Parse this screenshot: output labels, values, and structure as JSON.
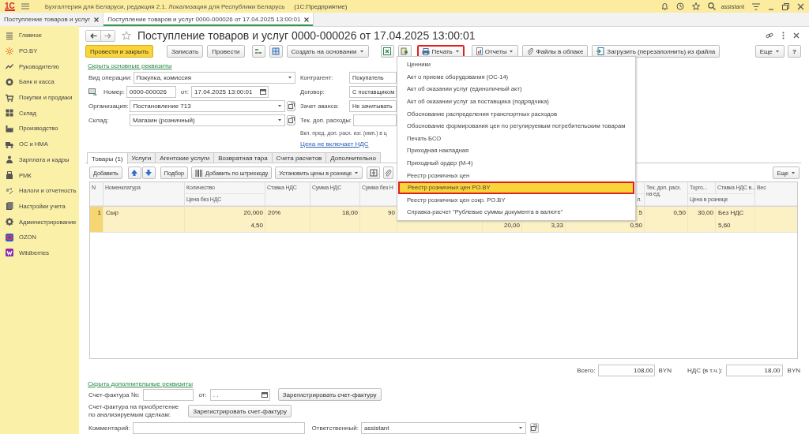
{
  "window": {
    "logo": "1С",
    "title": "Бухгалтерия для Беларуси, редакция 2.1. Локализация для Республики Беларусь",
    "app": "(1С:Предприятие)",
    "user": "assistant"
  },
  "open_tabs": [
    {
      "label": "Поступление товаров и услуг",
      "selected": false
    },
    {
      "label": "Поступление товаров и услуг 0000-000026 от 17.04.2025 13:00:01",
      "selected": true
    }
  ],
  "sidebar": {
    "items": [
      {
        "label": "Главное"
      },
      {
        "label": "PO.BY"
      },
      {
        "label": "Руководителю"
      },
      {
        "label": "Банк и касса"
      },
      {
        "label": "Покупки и продажи"
      },
      {
        "label": "Склад"
      },
      {
        "label": "Производство"
      },
      {
        "label": "ОС и НМА"
      },
      {
        "label": "Зарплата и кадры"
      },
      {
        "label": "РМК"
      },
      {
        "label": "Налоги и отчетность"
      },
      {
        "label": "Настройки учета"
      },
      {
        "label": "Администрирование"
      },
      {
        "label": "OZON"
      },
      {
        "label": "Wildberries"
      }
    ]
  },
  "document": {
    "title": "Поступление товаров и услуг 0000-000026 от 17.04.2025 13:00:01",
    "toolbar": {
      "post_close": "Провести и закрыть",
      "write": "Записать",
      "post": "Провести",
      "create_based": "Создать на основании",
      "reports": "Отчеты",
      "cloud_files": "Файлы в облаке",
      "load": "Загрузить (перезаполнить) из файла",
      "more": "Еще",
      "help": "?"
    },
    "print_button": {
      "label": "Печать",
      "expanded": true
    },
    "print_menu": {
      "items": [
        {
          "label": "Ценники",
          "selected": false
        },
        {
          "label": "Акт о приеме оборудования (ОС-14)",
          "selected": false
        },
        {
          "label": "Акт об оказании услуг (единоличный акт)",
          "selected": false
        },
        {
          "label": "Акт об оказании услуг за поставщика (подрядчика)",
          "selected": false
        },
        {
          "label": "Обоснование распределения транспортных расходов",
          "selected": false
        },
        {
          "label": "Обоснование формирования цен по регулируемым потребительским товарам",
          "selected": false
        },
        {
          "label": "Печать БСО",
          "selected": false
        },
        {
          "label": "Приходная накладная",
          "selected": false
        },
        {
          "label": "Приходный ордер (М-4)",
          "selected": false
        },
        {
          "label": "Реестр розничных цен",
          "selected": false
        },
        {
          "label": "Реестр розничных цен PO.BY",
          "selected": true
        },
        {
          "label": "Реестр розничных цен сокр. PO.BY",
          "selected": false
        },
        {
          "label": "Справка-расчет \"Рублевые суммы документа в валюте\"",
          "selected": false
        }
      ]
    },
    "hide_main_link": "Скрыть основные реквизиты",
    "fields_left": [
      {
        "kind": "select",
        "label": "Вид операции:",
        "value": "Покупка, комиссия"
      },
      {
        "kind": "number_date",
        "label": "Номер:",
        "value": "0000-000026",
        "date_label": "от:",
        "date_value": "17.04.2025 13:00:01"
      },
      {
        "kind": "select_open",
        "label": "Организация:",
        "value": "Постановление 713"
      },
      {
        "kind": "select_open",
        "label": "Склад:",
        "value": "Магазин (розничный)"
      }
    ],
    "fields_right": [
      {
        "label": "Контрагент:",
        "value": "Покупатель"
      },
      {
        "label": "Договор:",
        "value": "С поставщиком"
      },
      {
        "label": "Зачет аванса:",
        "value": "Не зачитывать"
      },
      {
        "label": "Тек. доп. расходы:"
      }
    ],
    "note": "Вкл. пред. доп. расх. изг. (имп.) в ц",
    "price_link": "Цена не включает НДС",
    "tabs": [
      {
        "label": "Товары (1)",
        "selected": true
      },
      {
        "label": "Услуги",
        "selected": false
      },
      {
        "label": "Агентские услуги",
        "selected": false
      },
      {
        "label": "Возвратная тара",
        "selected": false
      },
      {
        "label": "Счета расчетов",
        "selected": false
      },
      {
        "label": "Дополнительно",
        "selected": false
      }
    ],
    "table_toolbar": {
      "add": "Добавить",
      "pick": "Подбор",
      "barcode": "Добавить по штрихкоду",
      "set_prices": "Установить цены в рознице",
      "more": "Еще"
    },
    "table": {
      "columns": [
        {
          "header": "N"
        },
        {
          "header": "Номенклатура"
        },
        {
          "header": "Количество",
          "header_2": "Цена без НДС"
        },
        {
          "header": "Ставка НДС"
        },
        {
          "header": "Сумма НДС"
        },
        {
          "header": "Сумма без Н"
        },
        {},
        {},
        {},
        {
          "header_2": "л."
        },
        {
          "header": "Тек. доп. расх.\nна ед."
        },
        {
          "header": "Торго...",
          "header_2": "Цена в рознице"
        },
        {
          "header": "Ставка НДС в..."
        },
        {
          "header": "Вес"
        }
      ],
      "rows": [
        {
          "selected": true,
          "line_1": {
            "column_1": "1",
            "column_2": "Сыр",
            "column_3": "20,000",
            "column_4": "20%",
            "column_5": "18,00",
            "column_6": "90",
            "column_10": "5",
            "column_11": "0,50",
            "column_12": "30,00",
            "column_13": "Без НДС"
          },
          "line_2": {
            "column_3": "4,50",
            "column_8": "20,00",
            "column_9": "3,33",
            "column_10": "0,50",
            "column_13": "5,60"
          }
        }
      ]
    },
    "totals": {
      "total_label": "Всего:",
      "total": "108,00",
      "total_currency": "BYN",
      "vat_label": "НДС (в т.ч.):",
      "vat": "18,00",
      "vat_currency": "BYN"
    },
    "hide_extra_link": "Скрыть дополнительные реквизиты",
    "invoice": {
      "label": "Счет-фактура №:",
      "date_label": "от:",
      "date_value": ". .",
      "button": "Зарегистрировать счет-фактуру"
    },
    "invoice_2": {
      "label": "Счет-фактура на приобретение\nпо анализируемым сделкам:",
      "button": "Зарегистрировать счет-фактуру"
    },
    "comment_label": "Комментарий:",
    "responsible_label": "Ответственный:",
    "responsible": "assistant"
  }
}
